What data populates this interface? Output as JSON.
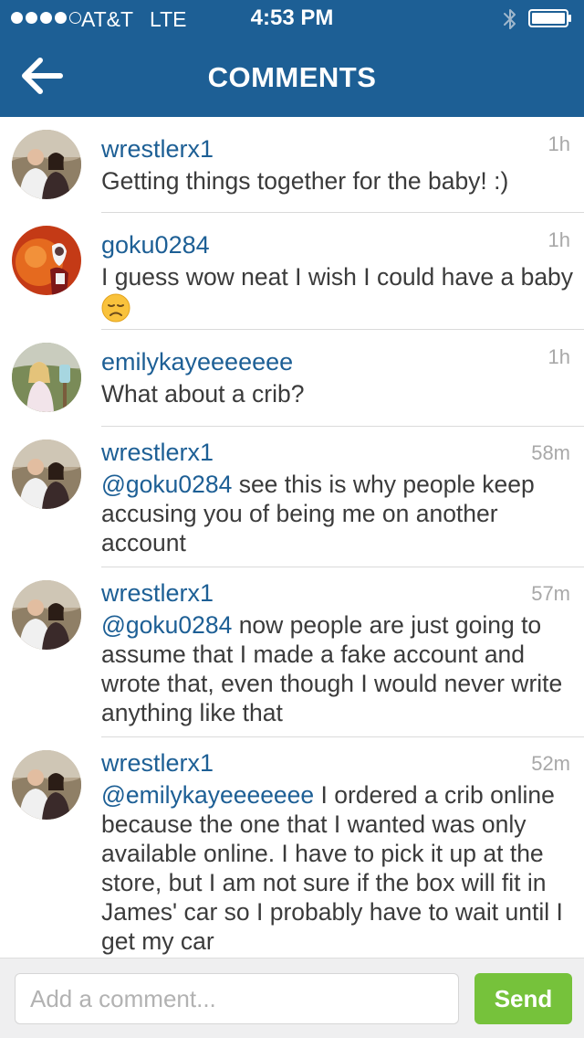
{
  "status_bar": {
    "carrier": "AT&T",
    "network": "LTE",
    "time": "4:53 PM",
    "signal_bars_filled": 4,
    "signal_bars_total": 5,
    "battery_level": 1.0
  },
  "nav": {
    "title": "COMMENTS",
    "back_icon": "arrow-left-icon"
  },
  "colors": {
    "header_bg": "#1d5f95",
    "username": "#1d5f95",
    "send_button": "#76c23b",
    "timestamp": "#a8a8a8"
  },
  "comments": [
    {
      "username": "wrestlerx1",
      "time": "1h",
      "text_parts": [
        {
          "text": "Getting things together for the baby! :)"
        }
      ]
    },
    {
      "username": "goku0284",
      "time": "1h",
      "text_parts": [
        {
          "text": "I guess wow neat I wish I could have a baby"
        }
      ],
      "emoji": "disappointed-face-icon"
    },
    {
      "username": "emilykayeeeeeee",
      "time": "1h",
      "text_parts": [
        {
          "text": "What about a crib?"
        }
      ]
    },
    {
      "username": "wrestlerx1",
      "time": "58m",
      "text_parts": [
        {
          "text": "@goku0284",
          "mention": true
        },
        {
          "text": " see this is why people keep accusing you of being me on another account"
        }
      ]
    },
    {
      "username": "wrestlerx1",
      "time": "57m",
      "text_parts": [
        {
          "text": "@goku0284",
          "mention": true
        },
        {
          "text": " now people are just going to assume that I made a fake account and wrote that, even though I would never write anything like that"
        }
      ]
    },
    {
      "username": "wrestlerx1",
      "time": "52m",
      "text_parts": [
        {
          "text": "@emilykayeeeeeee",
          "mention": true
        },
        {
          "text": " I ordered a crib online because the one that I wanted was only available online. I have to pick it up at the store, but I am not sure if the box will fit in James' car so I probably have to wait until I get my car"
        }
      ]
    }
  ],
  "composer": {
    "placeholder": "Add a comment...",
    "value": "",
    "send_label": "Send"
  }
}
